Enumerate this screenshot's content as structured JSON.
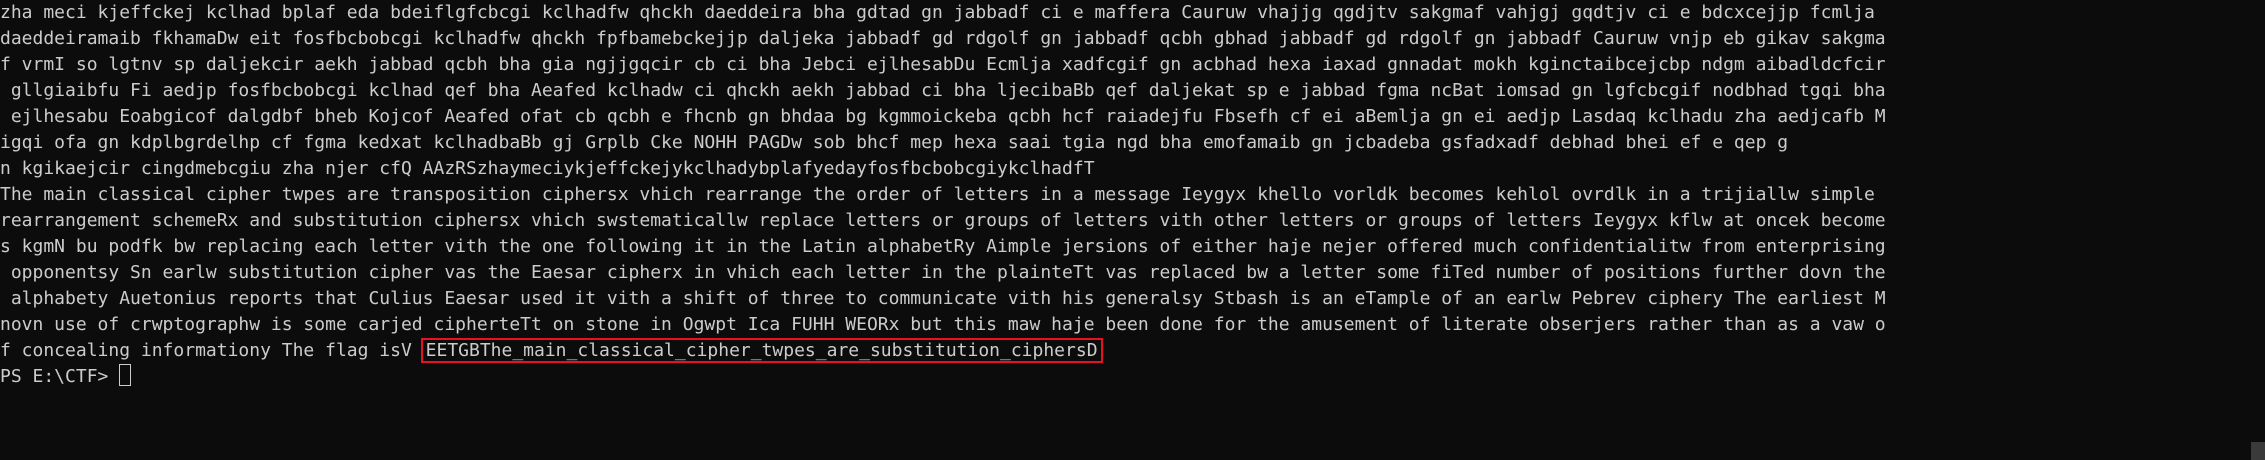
{
  "terminal": {
    "lines": [
      "zha meci kjeffckej kclhad bplaf eda bdeiflgfcbcgi kclhadfw qhckh daeddeira bha gdtad gn jabbadf ci e maffera Cauruw vhajjg qgdjtv sakgmaf vahjgj gqdtjv ci e bdcxcejjp fcmlja",
      "daeddeiramaib fkhamaDw eit fosfbcbobcgi kclhadfw qhckh fpfbamebckejjp daljeka jabbadf gd rdgolf gn jabbadf qcbh gbhad jabbadf gd rdgolf gn jabbadf Cauruw vnjp eb gikav sakgma",
      "f vrmI so lgtnv sp daljekcir aekh jabbad qcbh bha gia ngjjgqcir cb ci bha Jebci ejlhesabDu Ecmlja xadfcgif gn acbhad hexa iaxad gnnadat mokh kginctaibcejcbp ndgm aibadldcfcir",
      " gllgiaibfu Fi aedjp fosfbcbobcgi kclhad qef bha Aeafed kclhadw ci qhckh aekh jabbad ci bha ljecibaBb qef daljekat sp e jabbad fgma ncBat iomsad gn lgfcbcgif nodbhad tgqi bha",
      " ejlhesabu Eoabgicof dalgdbf bheb Kojcof Aeafed ofat cb qcbh e fhcnb gn bhdaa bg kgmmoickeba qcbh hcf raiadejfu Fbsefh cf ei aBemlja gn ei aedjp Lasdaq kclhadu zha aedjcafb M",
      "igqi ofa gn kdplbgrdelhp cf fgma kedxat kclhadbaBb gj Grplb Cke NOHH PAGDw sob bhcf mep hexa saai tgia ngd bha emofamaib gn jcbadeba gsfadxadf debhad bhei ef e qep g",
      "n kgikaejcir cingdmebcgiu zha njer cfQ AAzRSzhaymeciykjeffckejykclhadybplafyedayfosfbcbobcgiykclhadfT",
      "The main classical cipher twpes are transposition ciphersx vhich rearrange the order of letters in a message Ieygyx khello vorldk becomes kehlol ovrdlk in a trijiallw simple",
      "rearrangement schemeRx and substitution ciphersx vhich swstematicallw replace letters or groups of letters vith other letters or groups of letters Ieygyx kflw at oncek become",
      "s kgmN bu podfk bw replacing each letter vith the one following it in the Latin alphabetRy Aimple jersions of either haje nejer offered much confidentialitw from enterprising",
      " opponentsy Sn earlw substitution cipher vas the Eaesar cipherx in vhich each letter in the plainteTt vas replaced bw a letter some fiTed number of positions further dovn the",
      " alphabety Auetonius reports that Culius Eaesar used it vith a shift of three to communicate vith his generalsy Stbash is an eTample of an earlw Pebrev ciphery The earliest M",
      "novn use of crwptographw is some carjed cipherteTt on stone in Ogwpt Ica FUHH WEORx but this maw haje been done for the amusement of literate obserjers rather than as a vaw o"
    ],
    "flag_line_prefix": "f concealing informationy The flag isV ",
    "flag_value": "EETGBThe_main_classical_cipher_twpes_are_substitution_ciphersD",
    "prompt": "PS E:\\CTF> "
  },
  "colors": {
    "background": "#0c0c0c",
    "foreground": "#cccccc",
    "highlight_box": "#e81123"
  }
}
